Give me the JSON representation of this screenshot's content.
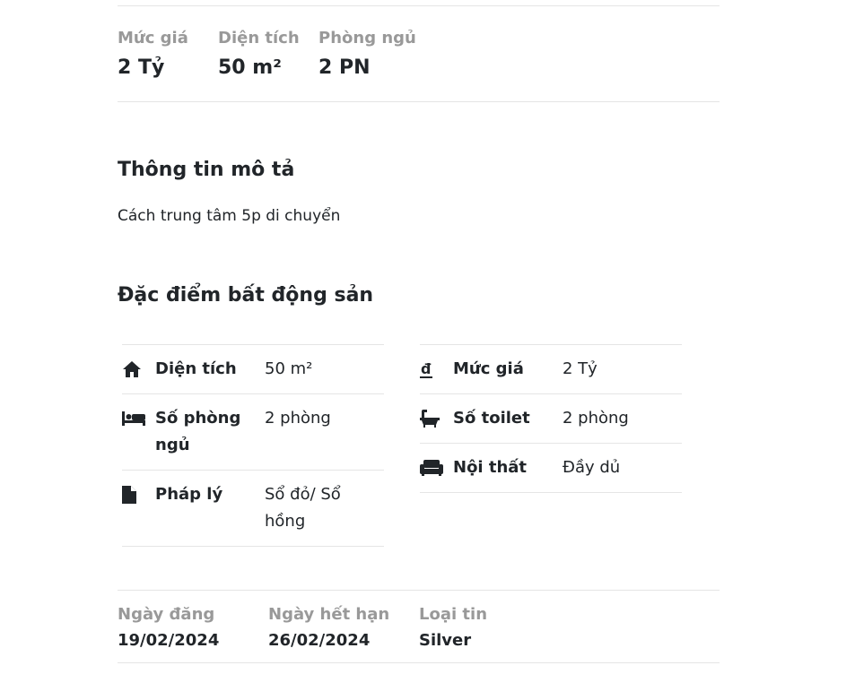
{
  "overview": [
    {
      "label": "Mức giá",
      "value": "2 Tỷ"
    },
    {
      "label": "Diện tích",
      "value": "50 m²"
    },
    {
      "label": "Phòng ngủ",
      "value": "2 PN"
    }
  ],
  "description": {
    "title": "Thông tin mô tả",
    "text": "Cách trung tâm 5p di chuyển"
  },
  "features": {
    "title": "Đặc điểm bất động sản",
    "left": [
      {
        "icon": "home-icon",
        "label": "Diện tích",
        "value": "50 m²"
      },
      {
        "icon": "bed-icon",
        "label": "Số phòng ngủ",
        "value": "2 phòng"
      },
      {
        "icon": "document-icon",
        "label": "Pháp lý",
        "value": "Sổ đỏ/ Sổ hồng"
      }
    ],
    "right": [
      {
        "icon": "currency-dong-icon",
        "label": "Mức giá",
        "value": "2 Tỷ"
      },
      {
        "icon": "bath-icon",
        "label": "Số toilet",
        "value": "2 phòng"
      },
      {
        "icon": "sofa-icon",
        "label": "Nội thất",
        "value": "Đầy dủ"
      }
    ]
  },
  "meta": [
    {
      "label": "Ngày đăng",
      "value": "19/02/2024"
    },
    {
      "label": "Ngày hết hạn",
      "value": "26/02/2024"
    },
    {
      "label": "Loại tin",
      "value": "Silver"
    }
  ]
}
